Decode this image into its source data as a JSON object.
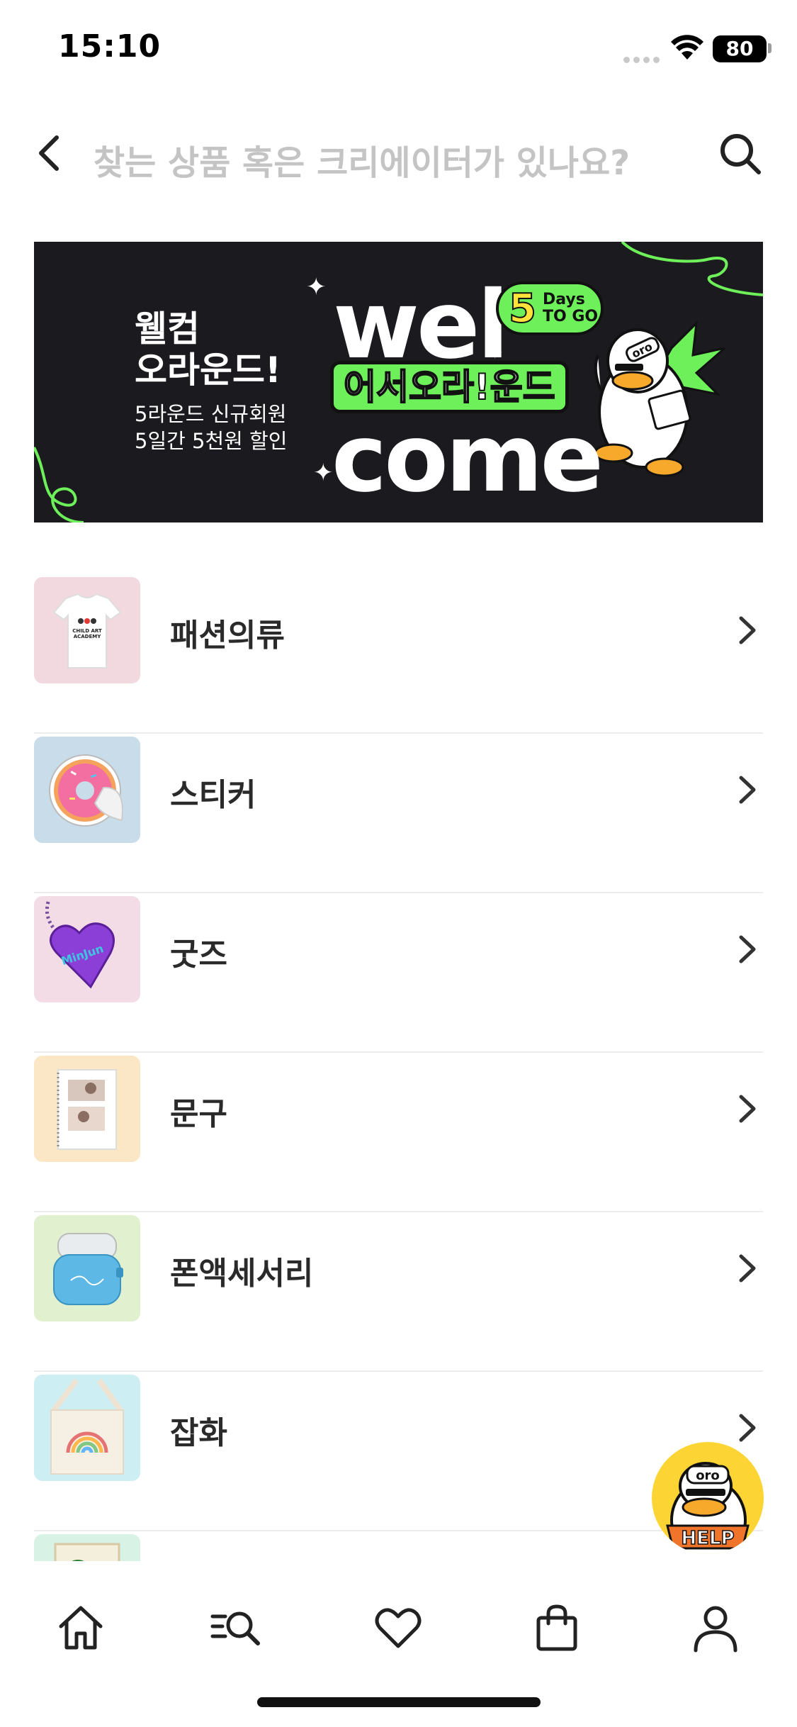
{
  "status_bar": {
    "time": "15:10",
    "battery": "80",
    "icons": [
      "signal-dots-icon",
      "wifi-icon",
      "battery-icon"
    ]
  },
  "search": {
    "placeholder": "찾는 상품 혹은 크리에이터가 있나요?",
    "icons": [
      "back-arrow-icon",
      "search-icon"
    ]
  },
  "banner": {
    "title_line1": "웰컴",
    "title_line2": "오라운드!",
    "subtitle_line1": "5라운드 신규회원",
    "subtitle_line2": "5일간 5천원 할인",
    "word_top": "wel",
    "word_bottom": "come",
    "slogan": "어서오라!운드",
    "days_number": "5",
    "days_text": "Days TO GO",
    "mascot_tag": "oro",
    "colors": {
      "background": "#1b1a1f",
      "accent": "#6ef05a"
    }
  },
  "categories": [
    {
      "label": "패션의류",
      "thumb_bg": "#f2d9df",
      "thumb_icon": "t-shirt-icon",
      "thumb_text": "CHILD ART ACADEMY"
    },
    {
      "label": "스티커",
      "thumb_bg": "#c9dcea",
      "thumb_icon": "donut-sticker-icon"
    },
    {
      "label": "굿즈",
      "thumb_bg": "#f4dce6",
      "thumb_icon": "heart-keyring-icon",
      "thumb_text": "MinJun"
    },
    {
      "label": "문구",
      "thumb_bg": "#fbe7c6",
      "thumb_icon": "notebook-icon"
    },
    {
      "label": "폰액세서리",
      "thumb_bg": "#e1f0cf",
      "thumb_icon": "airpods-case-icon"
    },
    {
      "label": "잡화",
      "thumb_bg": "#cdeef2",
      "thumb_icon": "tote-bag-icon"
    },
    {
      "label": "",
      "thumb_bg": "#d9f2e6",
      "thumb_icon": "frame-icon"
    }
  ],
  "help": {
    "label": "HELP",
    "icon": "help-mascot-icon",
    "tag": "oro"
  },
  "bottom_nav": [
    {
      "name": "home",
      "icon": "home-icon"
    },
    {
      "name": "category-search",
      "icon": "category-search-icon"
    },
    {
      "name": "wishlist",
      "icon": "heart-icon"
    },
    {
      "name": "cart",
      "icon": "shopping-bag-icon"
    },
    {
      "name": "my-page",
      "icon": "user-icon"
    }
  ]
}
